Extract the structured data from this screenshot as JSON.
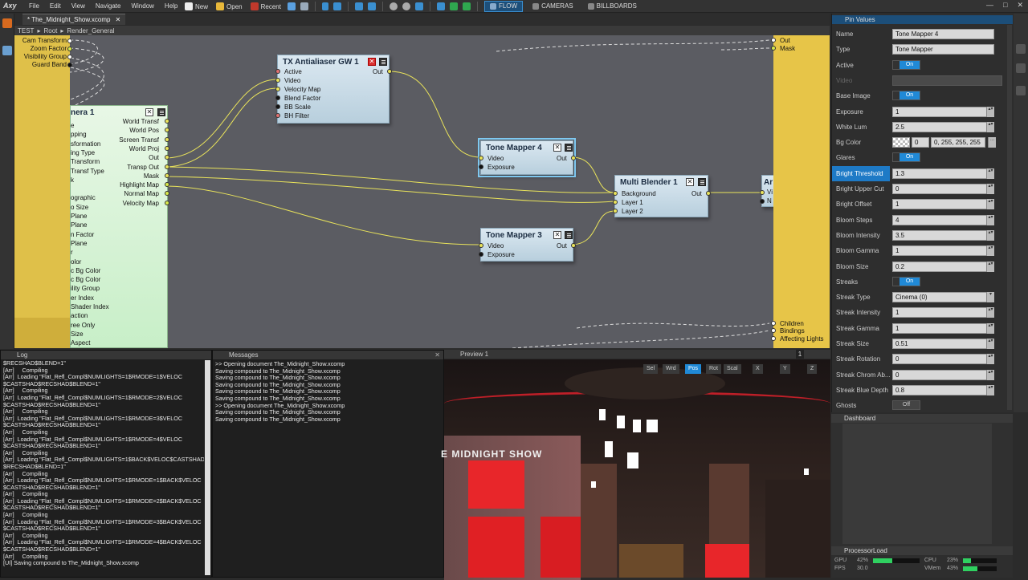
{
  "app": {
    "logo": "Axy"
  },
  "menu": [
    "File",
    "Edit",
    "View",
    "Navigate",
    "Window",
    "Help"
  ],
  "toolbar": {
    "new": "New",
    "open": "Open",
    "recent": "Recent"
  },
  "modes": [
    {
      "label": "FLOW",
      "active": true
    },
    {
      "label": "CAMERAS",
      "active": false
    },
    {
      "label": "BILLBOARDS",
      "active": false
    }
  ],
  "doc_tab": "* The_Midnight_Show.xcomp",
  "breadcrumb": [
    "TEST",
    "Root",
    "Render_General"
  ],
  "nodes": {
    "camera_left_labels": [
      "Cam Transform",
      "Zoom Factor",
      "Visibility Group",
      "Guard Band"
    ],
    "camera": {
      "title": "nera 1",
      "outs": [
        "World Transf",
        "World Pos",
        "Screen Transf",
        "World Proj",
        "Out",
        "Transp Out",
        "Mask",
        "Highlight Map",
        "Normal Map",
        "Velocity Map"
      ],
      "left": [
        "e",
        "pping",
        "sformation",
        "ing Type",
        "Transform",
        "Transf Type",
        "k",
        "",
        "ographic",
        "o Size",
        "Plane",
        "Plane",
        "n Factor",
        "Plane",
        "r",
        "olor",
        "c Bg Color",
        "c Bg Color",
        "ility Group",
        "er Index",
        "Shader Index",
        "action",
        "ree Only",
        "Size",
        "Aspect"
      ]
    },
    "aa": {
      "title": "TX Antialiaser GW 1",
      "pins": [
        "Active",
        "Video",
        "Velocity Map",
        "Blend Factor",
        "BB Scale",
        "BH Filter"
      ],
      "out": "Out"
    },
    "tm4": {
      "title": "Tone Mapper 4",
      "pins": [
        "Video",
        "Exposure"
      ],
      "out": "Out"
    },
    "tm3": {
      "title": "Tone Mapper 3",
      "pins": [
        "Video",
        "Exposure"
      ],
      "out": "Out"
    },
    "mb": {
      "title": "Multi Blender 1",
      "pins": [
        "Background",
        "Layer 1",
        "Layer 2"
      ],
      "out": "Out"
    },
    "partial": {
      "title": "Ar",
      "pins": [
        "Vi",
        "N"
      ]
    },
    "output": {
      "top": [
        "Out",
        "Mask"
      ],
      "bottom": [
        "Children",
        "Bindings",
        "Affecting Lights"
      ]
    }
  },
  "pin_panel": {
    "title": "Pin Values",
    "rows": [
      {
        "name": "Name",
        "type": "text",
        "value": "Tone Mapper 4"
      },
      {
        "name": "Type",
        "type": "text",
        "value": "Tone Mapper"
      },
      {
        "name": "Active",
        "type": "toggle",
        "value": "On"
      },
      {
        "name": "Video",
        "type": "disabled",
        "value": ""
      },
      {
        "name": "Base Image",
        "type": "toggle",
        "value": "On"
      },
      {
        "name": "Exposure",
        "type": "num",
        "value": "1"
      },
      {
        "name": "White Lum",
        "type": "num",
        "value": "2.5"
      },
      {
        "name": "Bg Color",
        "type": "color",
        "value": "0, 255, 255, 255",
        "alpha": "0"
      },
      {
        "name": "Glares",
        "type": "toggle",
        "value": "On"
      },
      {
        "name": "Bright Threshold",
        "type": "num",
        "value": "1.3",
        "selected": true
      },
      {
        "name": "Bright Upper Cut",
        "type": "num",
        "value": "0"
      },
      {
        "name": "Bright Offset",
        "type": "num",
        "value": "1"
      },
      {
        "name": "Bloom Steps",
        "type": "num",
        "value": "4"
      },
      {
        "name": "Bloom Intensity",
        "type": "num",
        "value": "3.5"
      },
      {
        "name": "Bloom Gamma",
        "type": "num",
        "value": "1"
      },
      {
        "name": "Bloom Size",
        "type": "num",
        "value": "0.2"
      },
      {
        "name": "Streaks",
        "type": "toggle",
        "value": "On"
      },
      {
        "name": "Streak Type",
        "type": "select",
        "value": "Cinema (0)"
      },
      {
        "name": "Streak Intensity",
        "type": "num",
        "value": "1"
      },
      {
        "name": "Streak Gamma",
        "type": "num",
        "value": "1"
      },
      {
        "name": "Streak Size",
        "type": "num",
        "value": "0.51"
      },
      {
        "name": "Streak Rotation",
        "type": "num",
        "value": "0"
      },
      {
        "name": "Streak Chrom Ab...",
        "type": "num",
        "value": "0"
      },
      {
        "name": "Streak Blue Depth",
        "type": "num",
        "value": "0.8"
      },
      {
        "name": "Ghosts",
        "type": "toggleoff",
        "value": "Off"
      }
    ]
  },
  "dashboard": {
    "title": "Dashboard"
  },
  "processor": {
    "title": "ProcessorLoad",
    "gpu_label": "GPU",
    "gpu": "42%",
    "gpu_pct": 42,
    "fps_label": "FPS",
    "fps": "30.0",
    "cpu_label": "CPU",
    "cpu": "23%",
    "cpu_pct": 23,
    "vmem_label": "VMem",
    "vmem": "43%",
    "vmem_pct": 43
  },
  "log": {
    "title": "Log",
    "text": "$RECSHAD$BLEND=1\"\n[Arr]     Compiling\n[Arr]  Loading \"Flat_Refl_Compl$NUMLIGHTS=1$RMODE=1$VELOC\n$CASTSHAD$RECSHAD$BLEND=1\"\n[Arr]     Compiling\n[Arr]  Loading \"Flat_Refl_Compl$NUMLIGHTS=1$RMODE=2$VELOC\n$CASTSHAD$RECSHAD$BLEND=1\"\n[Arr]     Compiling\n[Arr]  Loading \"Flat_Refl_Compl$NUMLIGHTS=1$RMODE=3$VELOC\n$CASTSHAD$RECSHAD$BLEND=1\"\n[Arr]     Compiling\n[Arr]  Loading \"Flat_Refl_Compl$NUMLIGHTS=1$RMODE=4$VELOC\n$CASTSHAD$RECSHAD$BLEND=1\"\n[Arr]     Compiling\n[Arr]  Loading \"Flat_Refl_Compl$NUMLIGHTS=1$BACK$VELOC$CASTSHAD\n$RECSHAD$BLEND=1\"\n[Arr]     Compiling\n[Arr]  Loading \"Flat_Refl_Compl$NUMLIGHTS=1$RMODE=1$BACK$VELOC\n$CASTSHAD$RECSHAD$BLEND=1\"\n[Arr]     Compiling\n[Arr]  Loading \"Flat_Refl_Compl$NUMLIGHTS=1$RMODE=2$BACK$VELOC\n$CASTSHAD$RECSHAD$BLEND=1\"\n[Arr]     Compiling\n[Arr]  Loading \"Flat_Refl_Compl$NUMLIGHTS=1$RMODE=3$BACK$VELOC\n$CASTSHAD$RECSHAD$BLEND=1\"\n[Arr]     Compiling\n[Arr]  Loading \"Flat_Refl_Compl$NUMLIGHTS=1$RMODE=4$BACK$VELOC\n$CASTSHAD$RECSHAD$BLEND=1\"\n[Arr]     Compiling\n[UI] Saving compound to The_Midnight_Show.xcomp"
  },
  "messages": {
    "title": "Messages",
    "text": ">> Opening document The_Midnight_Show.xcomp\nSaving compound to The_Midnight_Show.xcomp\nSaving compound to The_Midnight_Show.xcomp\nSaving compound to The_Midnight_Show.xcomp\nSaving compound to The_Midnight_Show.xcomp\nSaving compound to The_Midnight_Show.xcomp\n>> Opening document The_Midnight_Show.xcomp\nSaving compound to The_Midnight_Show.xcomp\nSaving compound to The_Midnight_Show.xcomp"
  },
  "preview": {
    "title": "Preview 1",
    "num": "1",
    "buttons": [
      {
        "label": "Sel",
        "active": false
      },
      {
        "label": "Wrd",
        "active": false
      },
      {
        "label": "Pos",
        "active": true
      },
      {
        "label": "Rot",
        "active": false
      },
      {
        "label": "Scal",
        "active": false
      }
    ],
    "axes": [
      "X",
      "Y",
      "Z"
    ],
    "sign": "E MIDNIGHT SHOW"
  },
  "colors": {
    "accent": "#2089d6",
    "wire": "#e9e35b",
    "canvas": "#5b5c62",
    "yellow_node": "#e7c548"
  }
}
